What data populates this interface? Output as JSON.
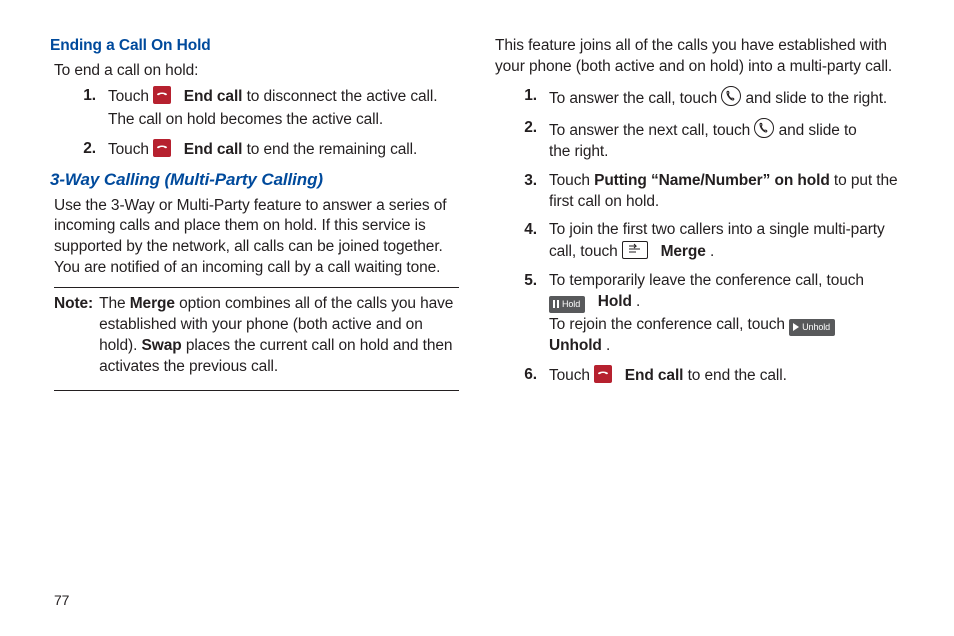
{
  "page_number": "77",
  "left": {
    "h1": "Ending a Call On Hold",
    "intro": "To end a call on hold:",
    "steps": [
      {
        "n": "1.",
        "a": "Touch ",
        "bold1": "End call",
        "b": " to disconnect the active call.",
        "c": "The call on hold becomes the active call."
      },
      {
        "n": "2.",
        "a": "Touch ",
        "bold1": "End call",
        "b": " to end the remaining call."
      }
    ],
    "h2": "3-Way Calling (Multi-Party Calling)",
    "para": "Use the 3-Way or Multi-Party feature to answer a series of incoming calls and place them on hold. If this service is supported by the network, all calls can be joined together. You are notified of an incoming call by a call waiting tone.",
    "note_label": "Note:",
    "note_a": "The ",
    "note_merge": "Merge",
    "note_b": " option combines all of the calls you have established with your phone (both active and on hold). ",
    "note_swap": "Swap",
    "note_c": " places the current call on hold and then activates the previous call."
  },
  "right": {
    "intro": "This feature joins all of the calls you have established with your phone (both active and on hold) into a multi-party call.",
    "steps": [
      {
        "n": "1.",
        "a": "To answer the call, touch ",
        "b": " and slide to the right."
      },
      {
        "n": "2.",
        "a": "To answer the next call, touch ",
        "b": " and slide to the right."
      },
      {
        "n": "3.",
        "a": "Touch ",
        "bold1": "Putting “Name/Number” on hold",
        "b": " to put the first call on hold."
      },
      {
        "n": "4.",
        "a": "To join the first two callers into a single multi-party call, touch ",
        "bold1": "Merge",
        "b": "."
      },
      {
        "n": "5.",
        "a": "To temporarily leave the conference call, touch ",
        "bold1": "Hold",
        "b": ".",
        "c1": "To rejoin the conference call, touch ",
        "cbold": "Unhold",
        "c2": "."
      },
      {
        "n": "6.",
        "a": "Touch ",
        "bold1": "End call",
        "b": " to end the call."
      }
    ],
    "hold_label": "Hold",
    "unhold_label": "Unhold"
  }
}
